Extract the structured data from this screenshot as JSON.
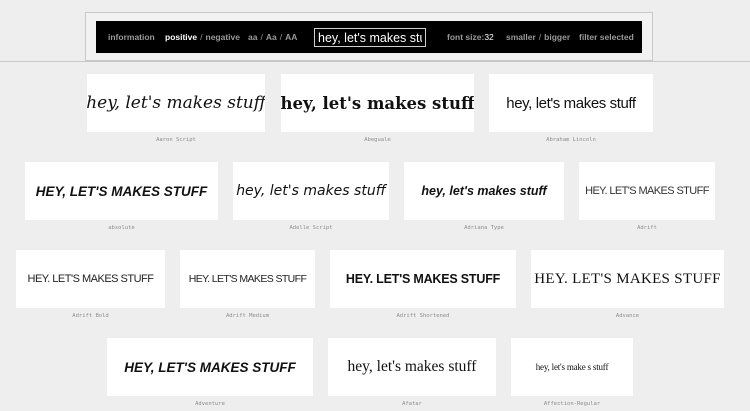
{
  "toolbar": {
    "information": "information",
    "positive": "positive",
    "slash1": "/",
    "negative": "negative",
    "aa_lower": "aa",
    "slash2": "/",
    "aa_title": "Aa",
    "slash3": "/",
    "aa_upper": "AA",
    "sample_text": "hey, let's makes stuff",
    "font_size_label": "font size:",
    "font_size_value": "32",
    "smaller": "smaller",
    "slash4": "/",
    "bigger": "bigger",
    "filter_selected": "filter selected"
  },
  "fonts": [
    {
      "name": "Aaron Script",
      "sample": "hey, let's makes stuff"
    },
    {
      "name": "Abeguale",
      "sample": "hey, let's makes stuff"
    },
    {
      "name": "Abraham Lincoln",
      "sample": "hey, let's makes stuff"
    },
    {
      "name": "absolute",
      "sample": "HEY, LET'S MAKES STUFF"
    },
    {
      "name": "Adelle Script",
      "sample": "hey, let's makes stuff"
    },
    {
      "name": "Adriana Type",
      "sample": "hey, let's makes stuff"
    },
    {
      "name": "Adrift",
      "sample": "HEY. LET'S MAKES STUFF"
    },
    {
      "name": "Adrift Bold",
      "sample": "HEY. LET'S MAKES STUFF"
    },
    {
      "name": "Adrift Medium",
      "sample": "HEY. LET'S MAKES STUFF"
    },
    {
      "name": "Adrift Shortened",
      "sample": "HEY. LET'S MAKES STUFF"
    },
    {
      "name": "Advance",
      "sample": "HEY. LET'S MAKES STUFF"
    },
    {
      "name": "Adventure",
      "sample": "HEY, LET'S MAKES STUFF"
    },
    {
      "name": "Afatar",
      "sample": "hey, let's makes stuff"
    },
    {
      "name": "Affection-Regular",
      "sample": "hey, let's make s stuff"
    }
  ]
}
